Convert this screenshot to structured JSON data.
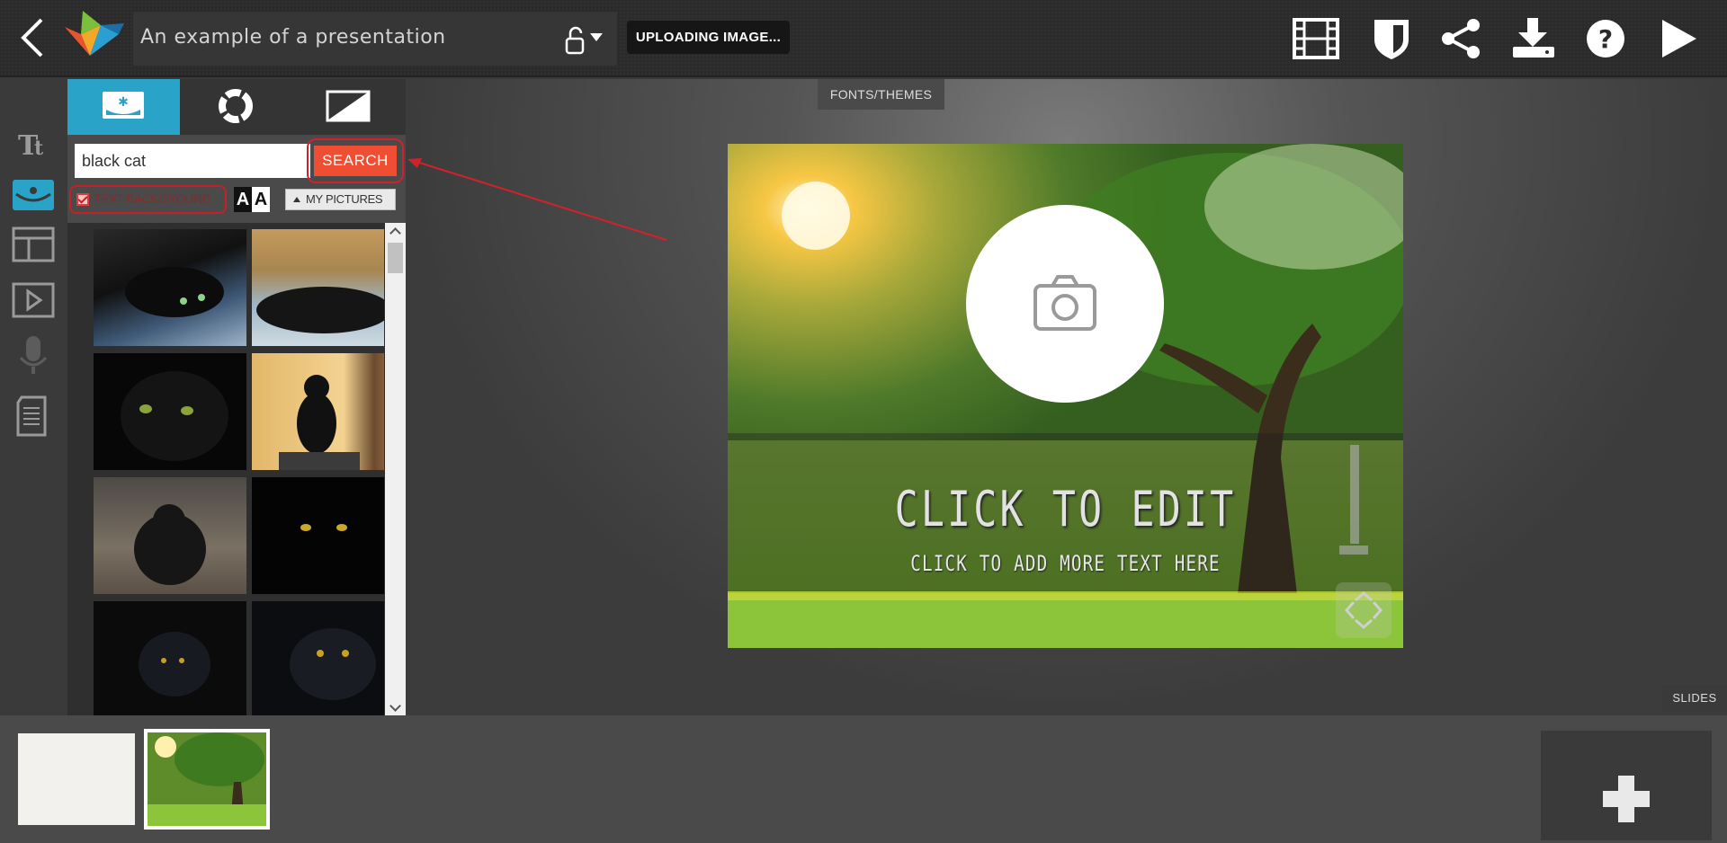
{
  "header": {
    "title": "An example of a presentation",
    "status": "UPLOADING IMAGE..."
  },
  "canvas": {
    "tab_label": "FONTS/THEMES",
    "slide_title": "CLICK TO EDIT",
    "slide_subtitle": "CLICK TO ADD MORE TEXT HERE"
  },
  "image_panel": {
    "search_value": "black cat",
    "search_button": "SEARCH",
    "text_background_label": "TEXT BACKGROUND",
    "text_background_checked": true,
    "my_pictures_label": "MY PICTURES",
    "aa_label_dark": "A",
    "aa_label_light": "A"
  },
  "footer": {
    "slides_label": "SLIDES"
  },
  "colors": {
    "accent_blue": "#2aa3c9",
    "search_orange": "#f04e33",
    "annotation_red": "#d3212b"
  }
}
